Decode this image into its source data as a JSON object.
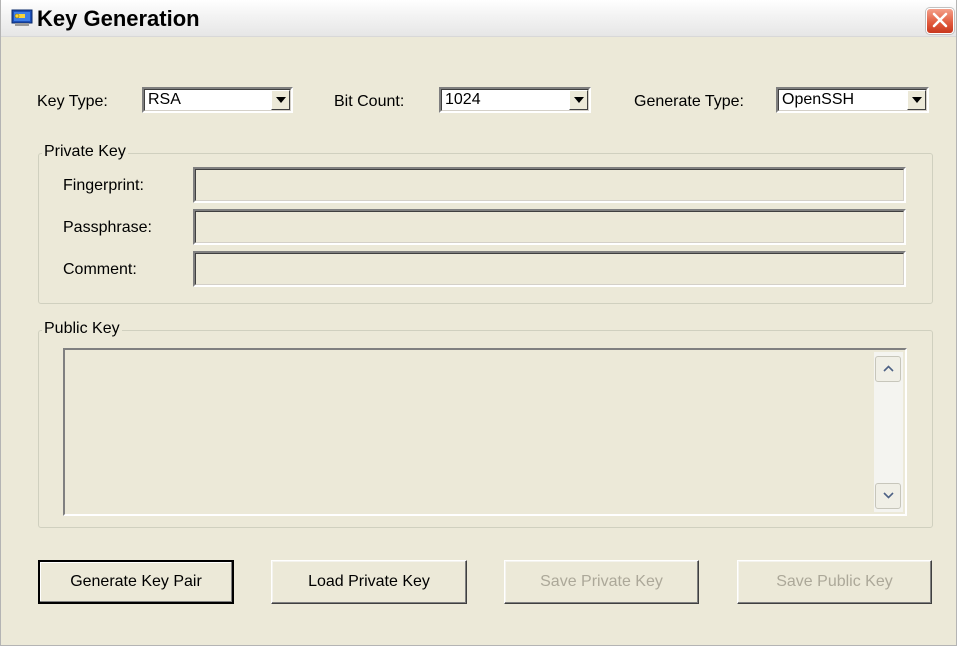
{
  "window": {
    "title": "Key Generation",
    "icon": "key-generation-app-icon",
    "close_icon": "close-icon"
  },
  "top_row": {
    "key_type": {
      "label": "Key Type:",
      "value": "RSA"
    },
    "bit_count": {
      "label": "Bit Count:",
      "value": "1024"
    },
    "generate_type": {
      "label": "Generate Type:",
      "value": "OpenSSH"
    }
  },
  "private_key": {
    "title": "Private Key",
    "fingerprint": {
      "label": "Fingerprint:",
      "value": ""
    },
    "passphrase": {
      "label": "Passphrase:",
      "value": ""
    },
    "comment": {
      "label": "Comment:",
      "value": ""
    }
  },
  "public_key": {
    "title": "Public Key",
    "value": ""
  },
  "buttons": {
    "generate": "Generate Key Pair",
    "load_private": "Load Private Key",
    "save_private": "Save Private Key",
    "save_public": "Save Public Key"
  },
  "colors": {
    "face": "#ece9d8",
    "disabled_text": "#aca899",
    "close_button": "#e0573a"
  }
}
